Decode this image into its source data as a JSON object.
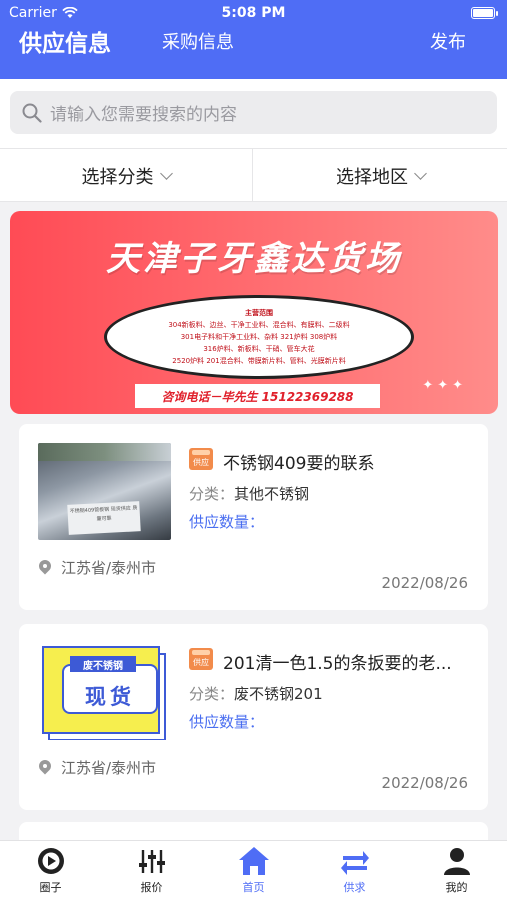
{
  "status_bar": {
    "carrier": "Carrier",
    "time": "5:08 PM"
  },
  "header": {
    "tab_supply": "供应信息",
    "tab_purchase": "采购信息",
    "publish": "发布",
    "bg_color": "#4f6df5"
  },
  "search": {
    "placeholder": "请输入您需要搜索的内容"
  },
  "filters": {
    "category": "选择分类",
    "region": "选择地区"
  },
  "banner": {
    "headline": "天津子牙鑫达货场",
    "scope_lines": [
      "主营范围",
      "304新板料、边丝、干净工业料、混合料、有膜料、二级料",
      "301电子料和干净工业料、杂料  321炉料  308炉料",
      "316炉料、新板料、干硝、管车大花",
      "2520炉料  201混合料、带膜新片料、管料、光膜新片料"
    ],
    "phone": "咨询电话－毕先生 15122369288",
    "sparkle": "✦✦✦"
  },
  "listings": [
    {
      "badge": "供应",
      "title": "不锈钢409要的联系",
      "category_label": "分类：",
      "category": "其他不锈钢",
      "quantity_label": "供应数量：",
      "location": "江苏省/泰州市",
      "date": "2022/08/26",
      "thumb_text": "不锈钢409管板钢\n现货供应 质量可靠"
    },
    {
      "badge": "供应",
      "title": "201清一色1.5的条扳要的老...",
      "category_label": "分类：",
      "category": "废不锈钢201",
      "quantity_label": "供应数量：",
      "location": "江苏省/泰州市",
      "date": "2022/08/26",
      "thumb_tag": "废不锈钢",
      "thumb_big": "现货"
    }
  ],
  "tabbar": [
    {
      "label": "圈子",
      "icon": "circle-play-icon"
    },
    {
      "label": "报价",
      "icon": "sliders-icon"
    },
    {
      "label": "首页",
      "icon": "home-icon",
      "active": true
    },
    {
      "label": "供求",
      "icon": "swap-arrows-icon"
    },
    {
      "label": "我的",
      "icon": "user-icon"
    }
  ]
}
